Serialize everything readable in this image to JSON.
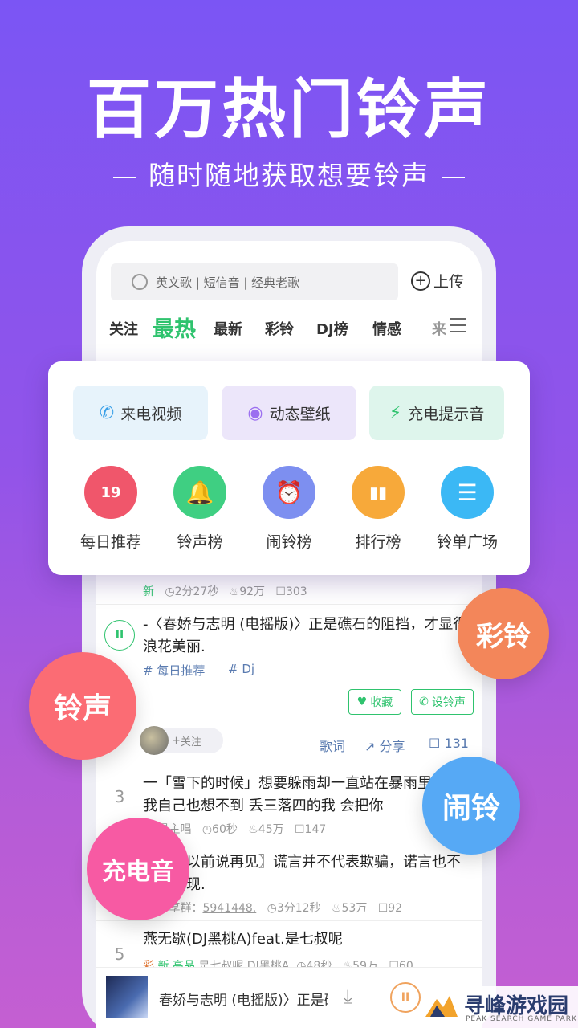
{
  "hero": {
    "title": "百万热门铃声",
    "subtitle": "随时随地获取想要铃声"
  },
  "app": {
    "search_placeholder": "英文歌 | 短信音 | 经典老歌",
    "upload_label": "上传",
    "tabs": [
      "关注",
      "最热",
      "最新",
      "彩铃",
      "DJ榜",
      "情感",
      "来"
    ],
    "active_tab": "最热"
  },
  "card": {
    "pills": [
      {
        "label": "来电视频",
        "icon": "phone-video-icon",
        "color": "#e7f3fb"
      },
      {
        "label": "动态壁纸",
        "icon": "wallpaper-icon",
        "color": "#ece6fa"
      },
      {
        "label": "充电提示音",
        "icon": "charging-icon",
        "color": "#def5ec"
      }
    ],
    "shortcuts": [
      {
        "label": "每日推荐",
        "glyph": "19",
        "icon": "calendar-icon",
        "color": "#f0566b"
      },
      {
        "label": "铃声榜",
        "glyph": "🔔",
        "icon": "bell-icon",
        "color": "#3fcf82"
      },
      {
        "label": "闹铃榜",
        "glyph": "⏰",
        "icon": "alarm-clock-icon",
        "color": "#7d8ff0"
      },
      {
        "label": "排行榜",
        "glyph": "▮▮",
        "icon": "bar-chart-icon",
        "color": "#f7a93a"
      },
      {
        "label": "铃单广场",
        "glyph": "☰",
        "icon": "list-icon",
        "color": "#3bb8f5"
      }
    ]
  },
  "list": {
    "row0": {
      "new": "新",
      "duration": "2分27秒",
      "likes": "92万",
      "comments": "303"
    },
    "row1": {
      "text": "-〈春娇与志明 (电摇版)〉正是礁石的阻挡，才显得浪花美丽.",
      "tag1": "# 每日推荐",
      "tag2": "# Dj",
      "fav": "收藏",
      "set": "设铃声",
      "follow": "关注",
      "lyrics": "歌词",
      "share": "分享",
      "comments": "131"
    },
    "row3": {
      "num": "3",
      "text": "一「雪下的时候」想要躲雨却一直站在暴雨里 就连我自己也想不到 丢三落四的我 会把你",
      "meta_prefix": "新 最主唱",
      "duration": "60秒",
      "likes": "45万",
      "comments": "147"
    },
    "row4": {
      "text": "〖天亮以前说再见〗谎言并不代表欺骗，诺言也不一定兑现.",
      "meta_prefix": "新 分享群：",
      "group": "5941448.",
      "duration": "3分12秒",
      "likes": "53万",
      "comments": "92"
    },
    "row5": {
      "num": "5",
      "text": "燕无歇(DJ黑桃A)feat.是七叔呢",
      "tag_hot": "彩",
      "tag_new": "新",
      "tag_hq": "高品",
      "artist": "是七叔呢,DJ黑桃A",
      "duration": "48秒",
      "likes": "59万",
      "comments": "60"
    }
  },
  "bubbles": {
    "caling": "彩铃",
    "lingsheng": "铃声",
    "naoling": "闹铃",
    "chongdian": "充电音"
  },
  "player": {
    "title": "春娇与志明 (电摇版)〉正是礁石"
  },
  "watermark": {
    "cn": "寻峰游戏园",
    "en": "PEAK SEARCH GAME PARK"
  }
}
